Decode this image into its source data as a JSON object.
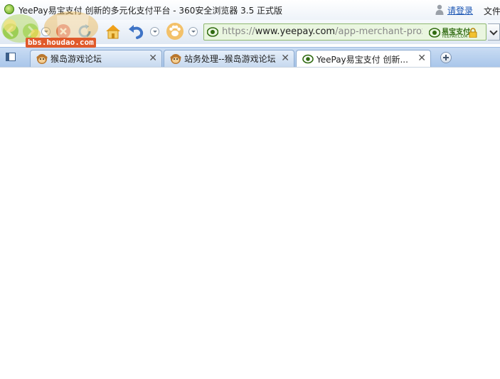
{
  "window": {
    "title": "YeePay易宝支付 创新的多元化支付平台 - 360安全浏览器 3.5 正式版"
  },
  "user": {
    "login_label": "请登录"
  },
  "menu": {
    "file_label": "文件"
  },
  "watermark": {
    "site": "bbs.houdao.com"
  },
  "toolbar": {
    "icons": [
      "back-icon",
      "forward-icon",
      "stop-icon",
      "refresh-icon",
      "home-icon",
      "undo-icon",
      "paw-icon"
    ]
  },
  "address_bar": {
    "scheme": "https://",
    "host": "www.yeepay.com",
    "path": "/app-merchant-prox",
    "cert_label": "易宝支付",
    "cert_sub": "YEEPAY.COM"
  },
  "tabs": [
    {
      "label": "猴岛游戏论坛",
      "icon": "monkey-icon",
      "active": false
    },
    {
      "label": "站务处理--猴岛游戏论坛",
      "icon": "monkey-icon",
      "active": false
    },
    {
      "label": "YeePay易宝支付 创新...",
      "icon": "yeepay-icon",
      "active": true
    }
  ],
  "colors": {
    "accent": "#1a55b3",
    "secure_green": "#2f6a10",
    "tab_strip": "#a9c6ea"
  }
}
